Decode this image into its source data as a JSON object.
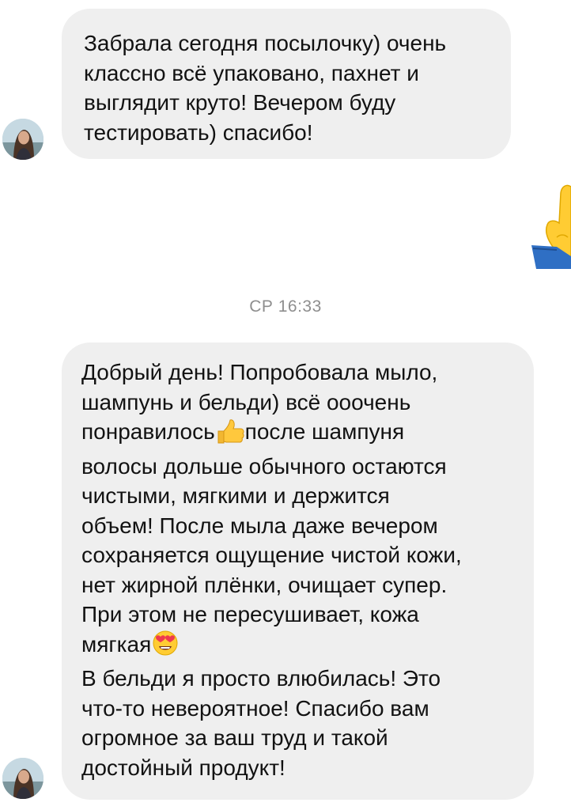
{
  "chat": {
    "messages": [
      {
        "lines": [
          "Забрала сегодня посылочку) очень",
          "классно всё упаковано, пахнет и",
          "выглядит круто! Вечером буду",
          "тестировать) спасибо!"
        ]
      },
      {
        "lines": [
          "Добрый день! Попробовала мыло,",
          "шампунь и бельди) всё ооочень",
          "понравилось",
          "после шампуня",
          "волосы дольше обычного остаются",
          "чистыми, мягкими и держится",
          "объем! После мыла даже вечером",
          "сохраняется ощущение чистой кожи,",
          "нет жирной плёнки, очищает супер.",
          "При этом не пересушивает, кожа",
          "мягкая",
          "В бельди я просто влюбилась! Это",
          "что-то невероятное! Спасибо вам",
          "огромное за ваш труд и такой",
          "достойный продукт!"
        ]
      }
    ],
    "timestamp": "СР 16:33",
    "icons": {
      "thumbs_up": "thumbs-up-emoji",
      "heart_eyes": "heart-eyes-emoji",
      "raised_hand": "raised-hand-emoji"
    },
    "colors": {
      "bubble": "#efefef",
      "timestamp": "#8e8e8e",
      "text": "#121212"
    }
  }
}
